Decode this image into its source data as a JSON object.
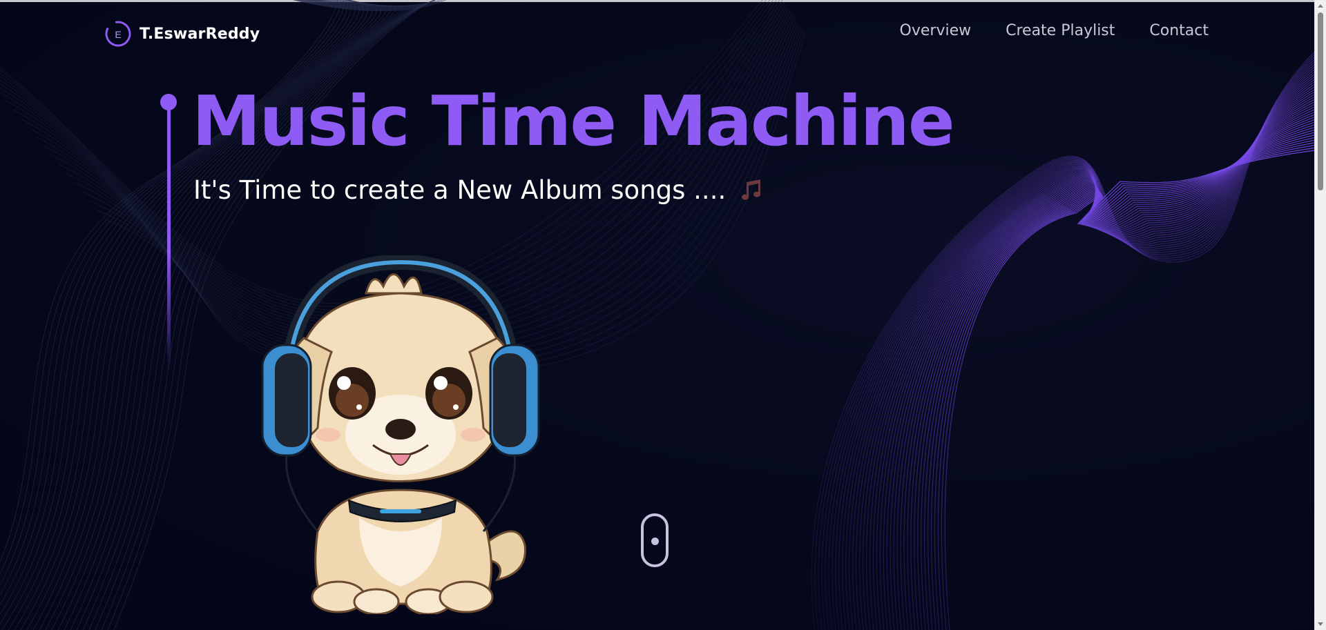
{
  "header": {
    "brand_name": "T.EswarReddy",
    "logo_letter": "E",
    "nav": [
      {
        "label": "Overview"
      },
      {
        "label": "Create Playlist"
      },
      {
        "label": "Contact"
      }
    ]
  },
  "hero": {
    "title": "Music Time Machine",
    "subtitle": "It's Time to create a New Album songs ...."
  },
  "icons": {
    "logo": "logo-circle-icon",
    "notes": "music-notes-icon",
    "mascot": "puppy-with-headphones",
    "scroll": "mouse-scroll-icon"
  },
  "colors": {
    "accent": "#8f5bf5",
    "background": "#05081a",
    "text": "#ffffff",
    "nav_text": "#c9c9d6"
  }
}
